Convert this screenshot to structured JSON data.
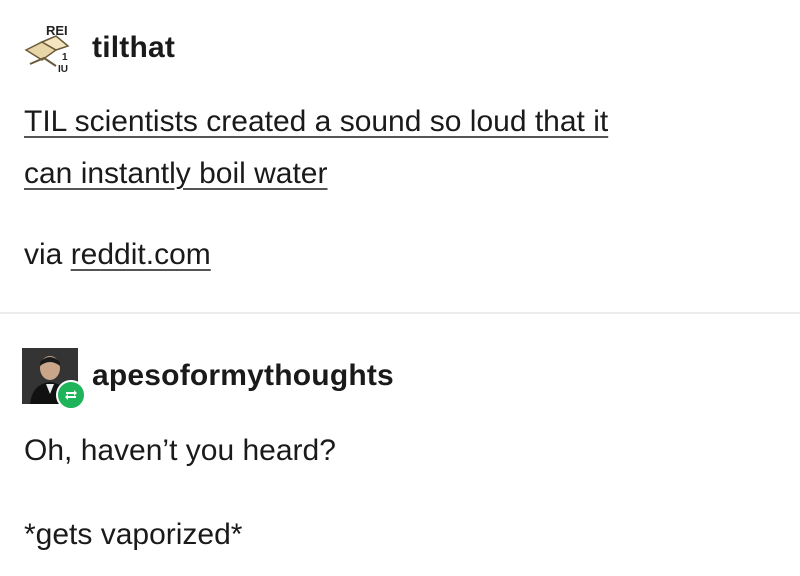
{
  "posts": [
    {
      "username": "tilthat",
      "avatar_icon": "book-logo-icon",
      "headline_line1": "TIL scientists created a sound so loud that it",
      "headline_line2": "can instantly boil water",
      "via_prefix": "via ",
      "via_link": "reddit.com"
    },
    {
      "username": "apesoformythoughts",
      "avatar_icon": "person-portrait-icon",
      "badge_icon": "reblog-icon",
      "lines": [
        "Oh, haven’t you heard?",
        "*gets vaporized*"
      ]
    }
  ],
  "colors": {
    "reblog_badge": "#1fb35a",
    "text": "#1a1a1a"
  }
}
